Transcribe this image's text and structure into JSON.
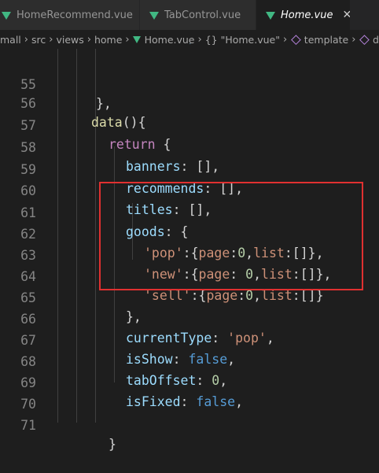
{
  "tabs": [
    {
      "label": "HomeRecommend.vue",
      "active": false
    },
    {
      "label": "TabControl.vue",
      "active": false
    },
    {
      "label": "Home.vue",
      "active": true
    }
  ],
  "close_glyph": "✕",
  "breadcrumb": {
    "items": [
      "mall",
      "src",
      "views",
      "home",
      "Home.vue",
      "{} \"Home.vue\"",
      "template",
      "d"
    ]
  },
  "colors": {
    "background": "#1e1e1e",
    "keyword": "#c586c0",
    "property": "#9cdcfe",
    "string": "#ce9178",
    "number": "#b5cea8",
    "boolean": "#569cd6",
    "highlight_box": "#e03030"
  },
  "code": {
    "lines": [
      {
        "num": "55",
        "text": "},"
      },
      {
        "num": "56",
        "text": "data(){"
      },
      {
        "num": "57",
        "text": "return {"
      },
      {
        "num": "58",
        "text": "banners: [],"
      },
      {
        "num": "59",
        "text": "recommends: [],"
      },
      {
        "num": "60",
        "text": "titles: [],"
      },
      {
        "num": "61",
        "text": "goods: {"
      },
      {
        "num": "62",
        "text": "'pop':{page:0,list:[]},"
      },
      {
        "num": "63",
        "text": "'new':{page: 0,list:[]},"
      },
      {
        "num": "64",
        "text": "'sell':{page:0,list:[]}"
      },
      {
        "num": "65",
        "text": "},"
      },
      {
        "num": "66",
        "text": "currentType: 'pop',"
      },
      {
        "num": "67",
        "text": "isShow: false,"
      },
      {
        "num": "68",
        "text": "tabOffset: 0,"
      },
      {
        "num": "69",
        "text": "isFixed: false,"
      },
      {
        "num": "70",
        "text": ""
      },
      {
        "num": "71",
        "text": "}"
      }
    ]
  }
}
